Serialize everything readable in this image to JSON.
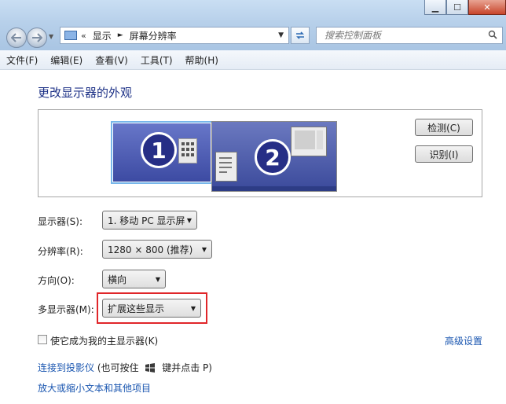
{
  "window": {
    "min_label": "▁",
    "max_label": "☐",
    "close_label": "✕"
  },
  "nav": {
    "back_icon": "back-arrow-icon",
    "forward_icon": "forward-arrow-icon"
  },
  "address": {
    "chevron": "«",
    "crumbs": [
      "显示",
      "屏幕分辨率"
    ],
    "separator": "►"
  },
  "search": {
    "placeholder": "搜索控制面板"
  },
  "menu": {
    "items": [
      "文件(F)",
      "编辑(E)",
      "查看(V)",
      "工具(T)",
      "帮助(H)"
    ]
  },
  "page": {
    "heading": "更改显示器的外观",
    "detect_label": "检测(C)",
    "identify_label": "识别(I)",
    "monitor1_number": "1",
    "monitor2_number": "2",
    "display_label": "显示器(S):",
    "display_value": "1. 移动 PC 显示屏",
    "resolution_label": "分辨率(R):",
    "resolution_value": "1280 × 800 (推荐)",
    "orientation_label": "方向(O):",
    "orientation_value": "横向",
    "multi_label": "多显示器(M):",
    "multi_value": "扩展这些显示",
    "main_display_label": "使它成为我的主显示器(K)",
    "main_display_checked": false,
    "advanced_link": "高级设置",
    "projector_link": "连接到投影仪",
    "projector_hint_pre": "(也可按住",
    "projector_hint_post": "键并点击 P)",
    "textsize_link": "放大或缩小文本和其他项目"
  },
  "colors": {
    "heading": "#1e3287",
    "link": "#1a56b0",
    "highlight": "#e0262a",
    "selected_monitor_border": "#77b6ea"
  }
}
